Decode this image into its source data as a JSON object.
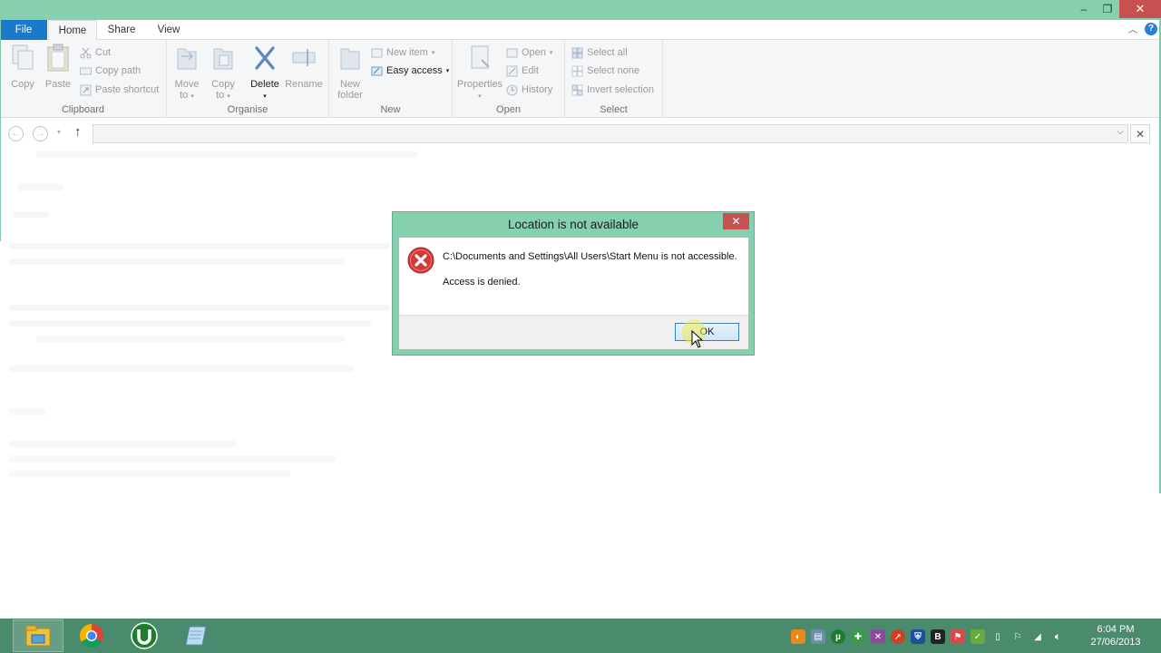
{
  "window": {
    "controls": {
      "minimize": "–",
      "restore": "❐",
      "close": "✕"
    }
  },
  "ribbon_tabs": {
    "file": "File",
    "home": "Home",
    "share": "Share",
    "view": "View"
  },
  "ribbon": {
    "clipboard": {
      "label": "Clipboard",
      "copy": "Copy",
      "paste": "Paste",
      "cut": "Cut",
      "copy_path": "Copy path",
      "paste_shortcut": "Paste shortcut"
    },
    "organise": {
      "label": "Organise",
      "move_to_1": "Move",
      "move_to_2": "to",
      "copy_to_1": "Copy",
      "copy_to_2": "to",
      "delete": "Delete",
      "rename": "Rename"
    },
    "new": {
      "label": "New",
      "new_folder_1": "New",
      "new_folder_2": "folder",
      "new_item": "New item",
      "easy_access": "Easy access"
    },
    "open": {
      "label": "Open",
      "properties": "Properties",
      "open": "Open",
      "edit": "Edit",
      "history": "History"
    },
    "select": {
      "label": "Select",
      "select_all": "Select all",
      "select_none": "Select none",
      "invert_selection": "Invert selection"
    }
  },
  "address_bar": {
    "value": ""
  },
  "dialog": {
    "title": "Location is not available",
    "message": "C:\\Documents and Settings\\All Users\\Start Menu is not accessible.",
    "detail": "Access is denied.",
    "ok_label": "OK"
  },
  "taskbar": {
    "apps": [
      "file-explorer",
      "chrome",
      "utorrent",
      "notepad"
    ],
    "clock_time": "6:04 PM",
    "clock_date": "27/06/2013"
  },
  "colors": {
    "accent": "#86d0b0",
    "file_tab": "#1979ca",
    "close": "#c75050",
    "taskbar": "#4a8b6d"
  }
}
